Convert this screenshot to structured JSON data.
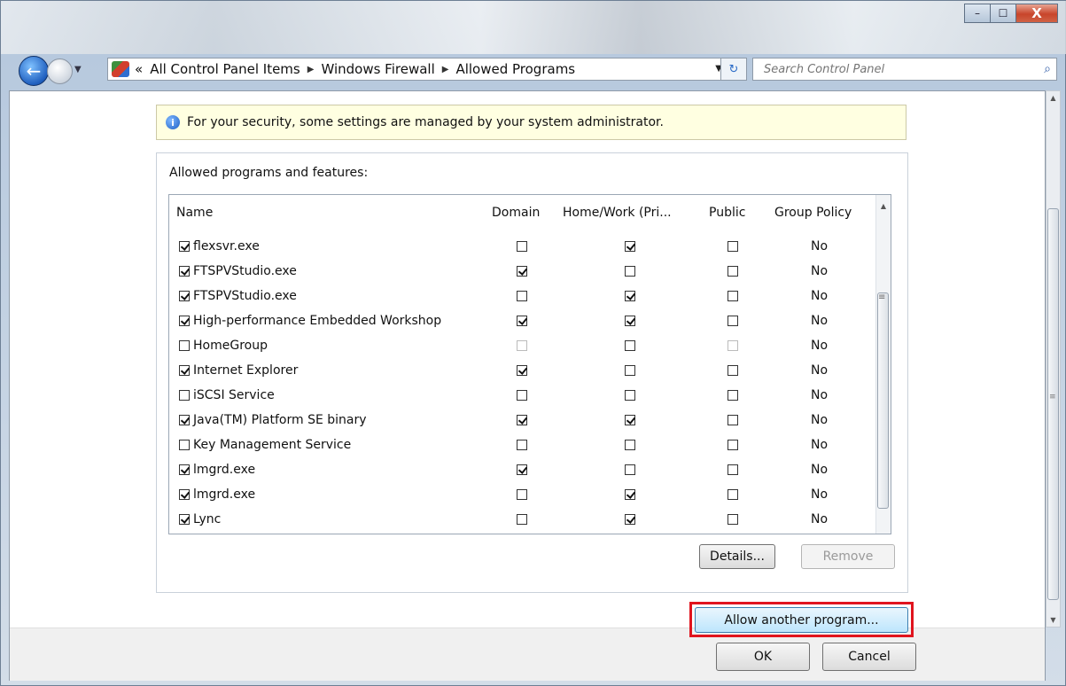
{
  "window": {
    "minimize_glyph": "–",
    "maximize_glyph": "☐",
    "close_glyph": "X"
  },
  "nav": {
    "back_glyph": "←",
    "breadcrumb_prefix": "«",
    "breadcrumbs": [
      "All Control Panel Items",
      "Windows Firewall",
      "Allowed Programs"
    ],
    "breadcrumb_separator": "▶",
    "dropdown_glyph": "▼",
    "refresh_glyph": "↻",
    "search_placeholder": "Search Control Panel",
    "search_icon_glyph": "⌕"
  },
  "info": {
    "icon_glyph": "i",
    "text": "For your security, some settings are managed by your system administrator."
  },
  "group": {
    "title": "Allowed programs and features:"
  },
  "table": {
    "columns": [
      "Name",
      "Domain",
      "Home/Work (Pri...",
      "Public",
      "Group Policy"
    ],
    "rows": [
      {
        "enabled": true,
        "name": "flexsvr.exe",
        "domain": false,
        "home": true,
        "public": false,
        "policy": "No"
      },
      {
        "enabled": true,
        "name": "FTSPVStudio.exe",
        "domain": true,
        "home": false,
        "public": false,
        "policy": "No"
      },
      {
        "enabled": true,
        "name": "FTSPVStudio.exe",
        "domain": false,
        "home": true,
        "public": false,
        "policy": "No"
      },
      {
        "enabled": true,
        "name": "High-performance Embedded Workshop",
        "domain": true,
        "home": true,
        "public": false,
        "policy": "No"
      },
      {
        "enabled": false,
        "name": "HomeGroup",
        "domain": false,
        "home": false,
        "public": false,
        "policy": "No",
        "disabled": true
      },
      {
        "enabled": true,
        "name": "Internet Explorer",
        "domain": true,
        "home": false,
        "public": false,
        "policy": "No"
      },
      {
        "enabled": false,
        "name": "iSCSI Service",
        "domain": false,
        "home": false,
        "public": false,
        "policy": "No"
      },
      {
        "enabled": true,
        "name": "Java(TM) Platform SE binary",
        "domain": true,
        "home": true,
        "public": false,
        "policy": "No"
      },
      {
        "enabled": false,
        "name": "Key Management Service",
        "domain": false,
        "home": false,
        "public": false,
        "policy": "No"
      },
      {
        "enabled": true,
        "name": "lmgrd.exe",
        "domain": true,
        "home": false,
        "public": false,
        "policy": "No"
      },
      {
        "enabled": true,
        "name": "lmgrd.exe",
        "domain": false,
        "home": true,
        "public": false,
        "policy": "No"
      },
      {
        "enabled": true,
        "name": "Lync",
        "domain": false,
        "home": true,
        "public": false,
        "policy": "No"
      }
    ]
  },
  "buttons": {
    "details": "Details...",
    "remove": "Remove",
    "allow_another": "Allow another program...",
    "ok": "OK",
    "cancel": "Cancel"
  },
  "scroll": {
    "up_glyph": "▲",
    "down_glyph": "▼",
    "grip_glyph": "≡"
  }
}
